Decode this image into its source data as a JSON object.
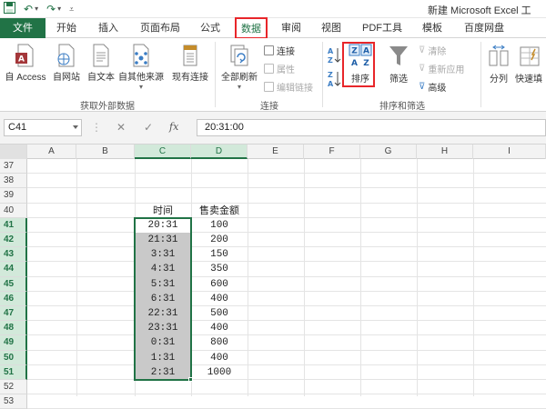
{
  "titlebar": {
    "title": "新建 Microsoft Excel 工"
  },
  "tabs": [
    {
      "label": "文件"
    },
    {
      "label": "开始"
    },
    {
      "label": "插入"
    },
    {
      "label": "页面布局"
    },
    {
      "label": "公式"
    },
    {
      "label": "数据"
    },
    {
      "label": "审阅"
    },
    {
      "label": "视图"
    },
    {
      "label": "PDF工具"
    },
    {
      "label": "模板"
    },
    {
      "label": "百度网盘"
    }
  ],
  "ribbon": {
    "get_external": {
      "buttons": [
        "自 Access",
        "自网站",
        "自文本",
        "自其他来源",
        "现有连接"
      ],
      "label": "获取外部数据"
    },
    "connections": {
      "refresh_all": "全部刷新",
      "items": [
        "连接",
        "属性",
        "编辑链接"
      ],
      "label": "连接"
    },
    "sort_filter": {
      "sort": "排序",
      "filter": "筛选",
      "items": [
        "清除",
        "重新应用",
        "高级"
      ],
      "label": "排序和筛选"
    },
    "tools": {
      "split": "分列",
      "flash": "快速填"
    }
  },
  "formula_bar": {
    "name_box": "C41",
    "formula": "20:31:00",
    "fx": "fx"
  },
  "columns": [
    "A",
    "B",
    "C",
    "D",
    "E",
    "F",
    "G",
    "H",
    "I"
  ],
  "rows": [
    "37",
    "38",
    "39",
    "40",
    "41",
    "42",
    "43",
    "44",
    "45",
    "46",
    "47",
    "48",
    "49",
    "50",
    "51",
    "52",
    "53"
  ],
  "table": {
    "headers": [
      "时间",
      "售卖金额"
    ],
    "data": [
      [
        "20:31",
        "100"
      ],
      [
        "21:31",
        "200"
      ],
      [
        "3:31",
        "150"
      ],
      [
        "4:31",
        "350"
      ],
      [
        "5:31",
        "600"
      ],
      [
        "6:31",
        "400"
      ],
      [
        "22:31",
        "500"
      ],
      [
        "23:31",
        "400"
      ],
      [
        "0:31",
        "800"
      ],
      [
        "1:31",
        "400"
      ],
      [
        "2:31",
        "1000"
      ]
    ]
  },
  "colors": {
    "excel_green": "#217346",
    "highlight_red": "#e8262a",
    "selection_fill": "#c9c9c9"
  }
}
